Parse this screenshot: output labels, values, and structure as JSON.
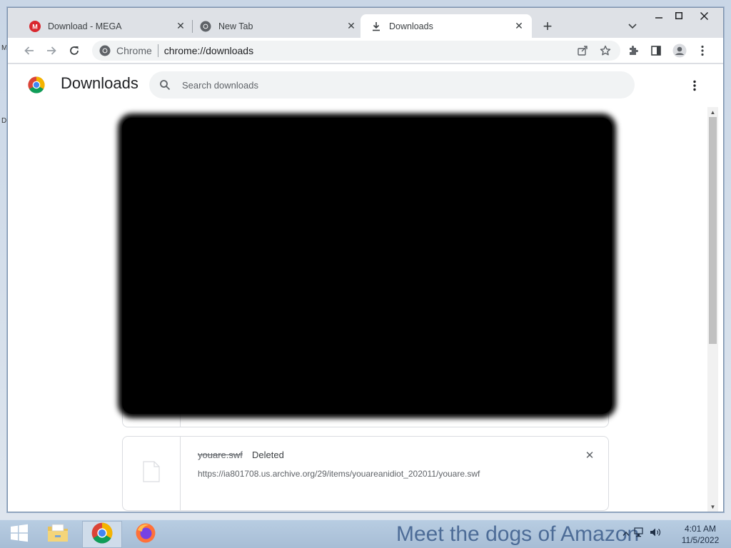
{
  "desktop": {
    "frag_left_top": "M",
    "frag_left_mid": "D"
  },
  "tabs": [
    {
      "title": "Download - MEGA",
      "favicon": "mega-icon"
    },
    {
      "title": "New Tab",
      "favicon": "chrome-icon"
    },
    {
      "title": "Downloads",
      "favicon": "download-icon",
      "active": true
    }
  ],
  "toolbar": {
    "site_label": "Chrome",
    "url": "chrome://downloads"
  },
  "downloads": {
    "title": "Downloads",
    "search_placeholder": "Search downloads",
    "items": [
      {
        "filename": "youare.swf",
        "status": "Deleted",
        "url": "https://ia801708.us.archive.org/29/items/youareanidiot_202011/youare.swf"
      }
    ]
  },
  "taskbar": {
    "apps": [
      "windows-start-icon",
      "file-explorer-icon",
      "chrome-icon",
      "firefox-icon"
    ],
    "banner": "Meet the dogs of Amazon",
    "time": "4:01 AM",
    "date": "11/5/2022"
  },
  "colors": {
    "accent": "#1a73e8",
    "mega_red": "#d9272e",
    "tab_strip": "#dee1e6"
  }
}
